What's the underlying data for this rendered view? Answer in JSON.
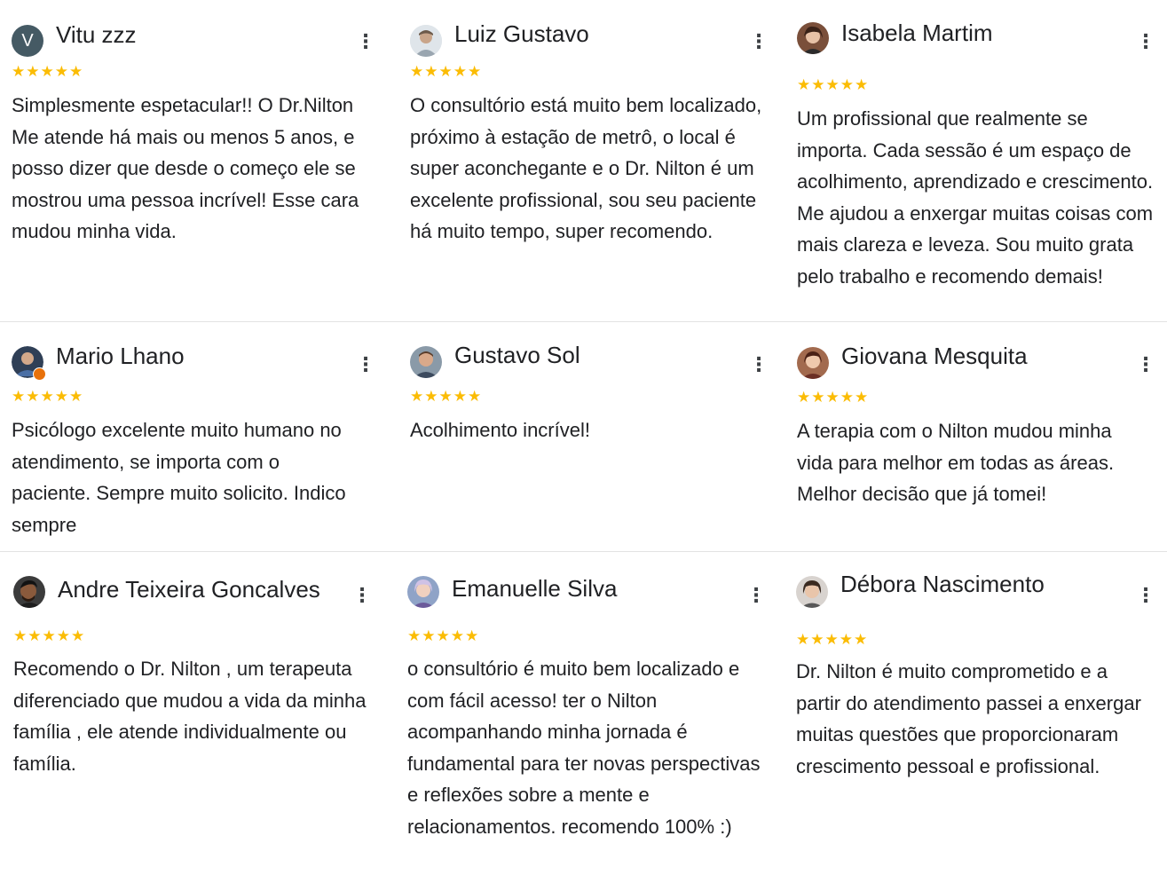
{
  "reviews": [
    {
      "name": "Vitu zzz",
      "avatar_letter": "V",
      "stars": "★★★★★",
      "text": "Simplesmente espetacular!! O Dr.Nilton Me atende há mais ou menos 5 anos, e posso dizer que desde o começo ele se mostrou uma pessoa incrível! Esse cara mudou minha vida.",
      "menu": "⋮"
    },
    {
      "name": "Luiz Gustavo",
      "stars": "★★★★★",
      "text": "O consultório está muito bem localizado, próximo à estação de metrô, o local é super aconchegante e o Dr. Nilton é um excelente profissional, sou seu paciente há muito tempo, super recomendo.",
      "menu": "⋮"
    },
    {
      "name": "Isabela Martim",
      "stars": "★★★★★",
      "text": "Um profissional que realmente se importa. Cada sessão é um espaço de acolhimento, aprendizado e crescimento. Me ajudou a enxergar muitas coisas com mais clareza e leveza. Sou muito grata pelo trabalho e recomendo demais!",
      "menu": "⋮"
    },
    {
      "name": "Mario Lhano",
      "stars": "★★★★★",
      "text": "Psicólogo excelente muito humano no atendimento, se importa com o paciente. Sempre muito solicito. Indico sempre",
      "menu": "⋮"
    },
    {
      "name": "Gustavo Sol",
      "stars": "★★★★★",
      "text": "Acolhimento incrível!",
      "menu": "⋮"
    },
    {
      "name": "Giovana Mesquita",
      "stars": "★★★★★",
      "text": "A terapia com o Nilton mudou minha vida para melhor em todas as áreas. Melhor decisão que já tomei!",
      "menu": "⋮"
    },
    {
      "name": "Andre Teixeira Goncalves",
      "stars": "★★★★★",
      "text": "Recomendo o Dr. Nilton , um terapeuta diferenciado que mudou a vida da minha família , ele atende individualmente ou família.",
      "menu": "⋮"
    },
    {
      "name": "Emanuelle Silva",
      "stars": "★★★★★",
      "text": "o consultório é muito bem localizado e com fácil acesso! ter o Nilton acompanhando minha jornada é fundamental para ter novas perspectivas e reflexões sobre a mente e relacionamentos. recomendo 100% :)",
      "menu": "⋮"
    },
    {
      "name": "Débora Nascimento",
      "stars": "★★★★★",
      "text": "Dr. Nilton é muito comprometido e a partir do atendimento passei a enxergar muitas questões que proporcionaram crescimento pessoal e profissional.",
      "menu": "⋮"
    }
  ],
  "colors": {
    "star": "#fbbc04",
    "text": "#202124",
    "divider": "#e3e3e3"
  }
}
